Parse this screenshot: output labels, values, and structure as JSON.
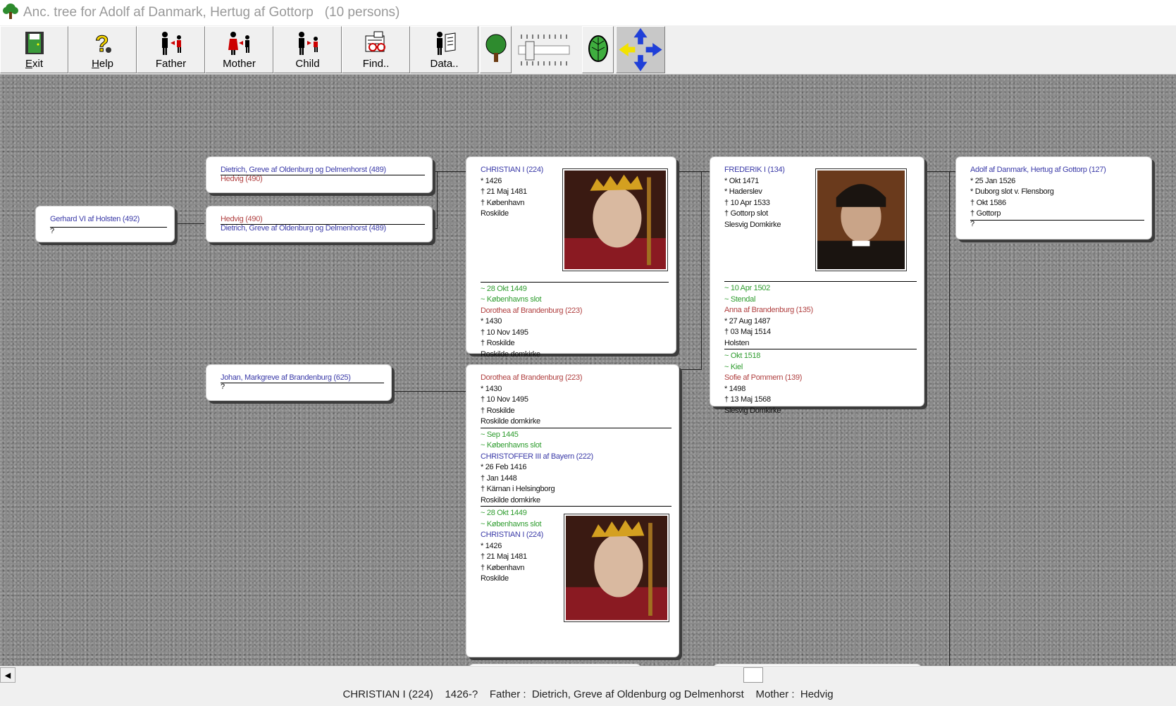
{
  "window": {
    "title": "Anc. tree for Adolf af Danmark, Hertug af Gottorp   (10 persons)"
  },
  "toolbar": {
    "exit": "Exit",
    "help": "Help",
    "father": "Father",
    "mother": "Mother",
    "child": "Child",
    "find": "Find..",
    "data": "Data.."
  },
  "cards": {
    "gerhard": {
      "name": "Gerhard VI af Holsten  (492)",
      "spouse": "?"
    },
    "dietrich1": {
      "name": "Dietrich, Greve af Oldenburg og Delmenhorst (489)",
      "spouse": "Hedvig     (490)"
    },
    "hedvig": {
      "name": "Hedvig     (490)",
      "spouse": "Dietrich, Greve af Oldenburg og Delmenhorst (489)"
    },
    "johan": {
      "name": "Johan, Markgreve af Brandenburg (625)",
      "spouse": "?"
    },
    "christian": {
      "name": "CHRISTIAN I (224)",
      "born": "* 1426",
      "died": "† 21 Maj 1481",
      "died_place": "† København",
      "burial": "Roskilde",
      "marr_date": "~ 28 Okt 1449",
      "marr_place": "~ Københavns slot",
      "spouse": "Dorothea af  Brandenburg  (223)",
      "s_born": "* 1430",
      "s_died": "† 10 Nov 1495",
      "s_died_place": "† Roskilde",
      "s_burial": "Roskilde domkirke"
    },
    "dorothea": {
      "name": "Dorothea af  Brandenburg  (223)",
      "born": "* 1430",
      "died": "† 10 Nov 1495",
      "died_place": "† Roskilde",
      "burial": "Roskilde domkirke",
      "m1_date": "~ Sep 1445",
      "m1_place": "~ Københavns slot",
      "s1_name": "CHRISTOFFER  III af Bayern (222)",
      "s1_born": "* 26 Feb 1416",
      "s1_died": "† Jan 1448",
      "s1_died_place": "† Kärnan i Helsingborg",
      "s1_burial": "Roskilde domkirke",
      "m2_date": "~ 28 Okt 1449",
      "m2_place": "~ Københavns slot",
      "s2_name": "CHRISTIAN I (224)",
      "s2_born": "* 1426",
      "s2_died": "† 21 Maj 1481",
      "s2_died_place": "† København",
      "s2_burial": "Roskilde"
    },
    "frederik": {
      "name": "FREDERIK   I (134)",
      "born": "* Okt 1471",
      "born_place": "* Haderslev",
      "died": "† 10 Apr 1533",
      "died_place": "† Gottorp slot",
      "burial": "Slesvig Domkirke",
      "m1_date": "~ 10 Apr 1502",
      "m1_place": "~ Stendal",
      "s1_name": "Anna af  Brandenburg  (135)",
      "s1_born": "* 27 Aug 1487",
      "s1_died": "† 03 Maj 1514",
      "s1_burial": "Holsten",
      "m2_date": "~ Okt 1518",
      "m2_place": "~ Kiel",
      "s2_name": "Sofie af  Pommern  (139)",
      "s2_born": "* 1498",
      "s2_died": "† 13 Maj 1568",
      "s2_burial": "Slesvig Domkirke"
    },
    "adolf": {
      "name": "Adolf af Danmark, Hertug af Gottorp (127)",
      "born": "* 25 Jan 1526",
      "born_place": "* Duborg slot v. Flensborg",
      "died": "† Okt 1586",
      "died_place": "† Gottorp",
      "spouse": "?"
    }
  },
  "status": {
    "text": "CHRISTIAN I (224)    1426-?    Father :  Dietrich, Greve af Oldenburg og Delmenhorst    Mother :  Hedvig"
  },
  "colors": {
    "name_blue": "#3b3ba8",
    "spouse_red": "#b04040",
    "marriage_green": "#2e9c2e",
    "background_gray": "#8a8a8a"
  }
}
